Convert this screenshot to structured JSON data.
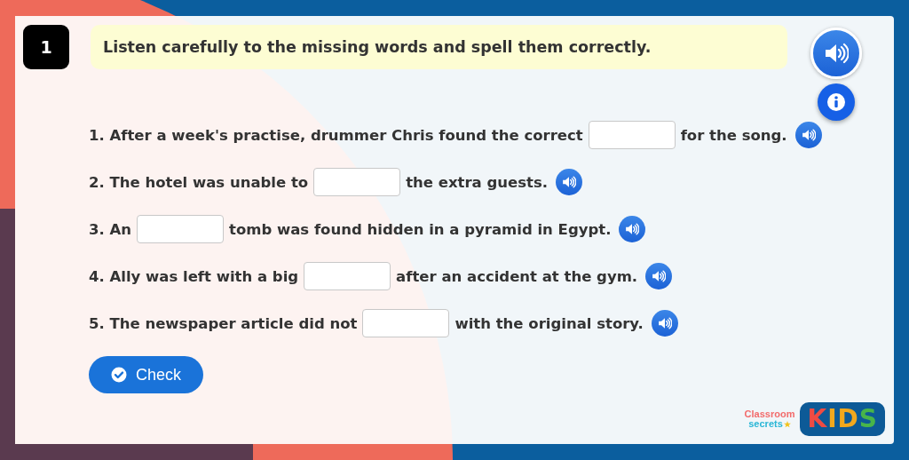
{
  "question_number": "1",
  "instruction": "Listen carefully to the missing words and spell them correctly.",
  "questions": [
    {
      "before": "1. After a week's practise, drummer Chris found the correct",
      "after": "for the song."
    },
    {
      "before": "2. The hotel was unable to",
      "after": "the extra guests."
    },
    {
      "before": "3. An",
      "after": "tomb was found hidden in a pyramid in Egypt."
    },
    {
      "before": "4. Ally was left with a big",
      "after": "after an accident at the gym."
    },
    {
      "before": "5. The newspaper article did not",
      "after": "with the original story."
    }
  ],
  "check_button": "Check",
  "logo": {
    "line_1": "Classroom",
    "line_2": "secrets",
    "badge": "KIDS"
  }
}
